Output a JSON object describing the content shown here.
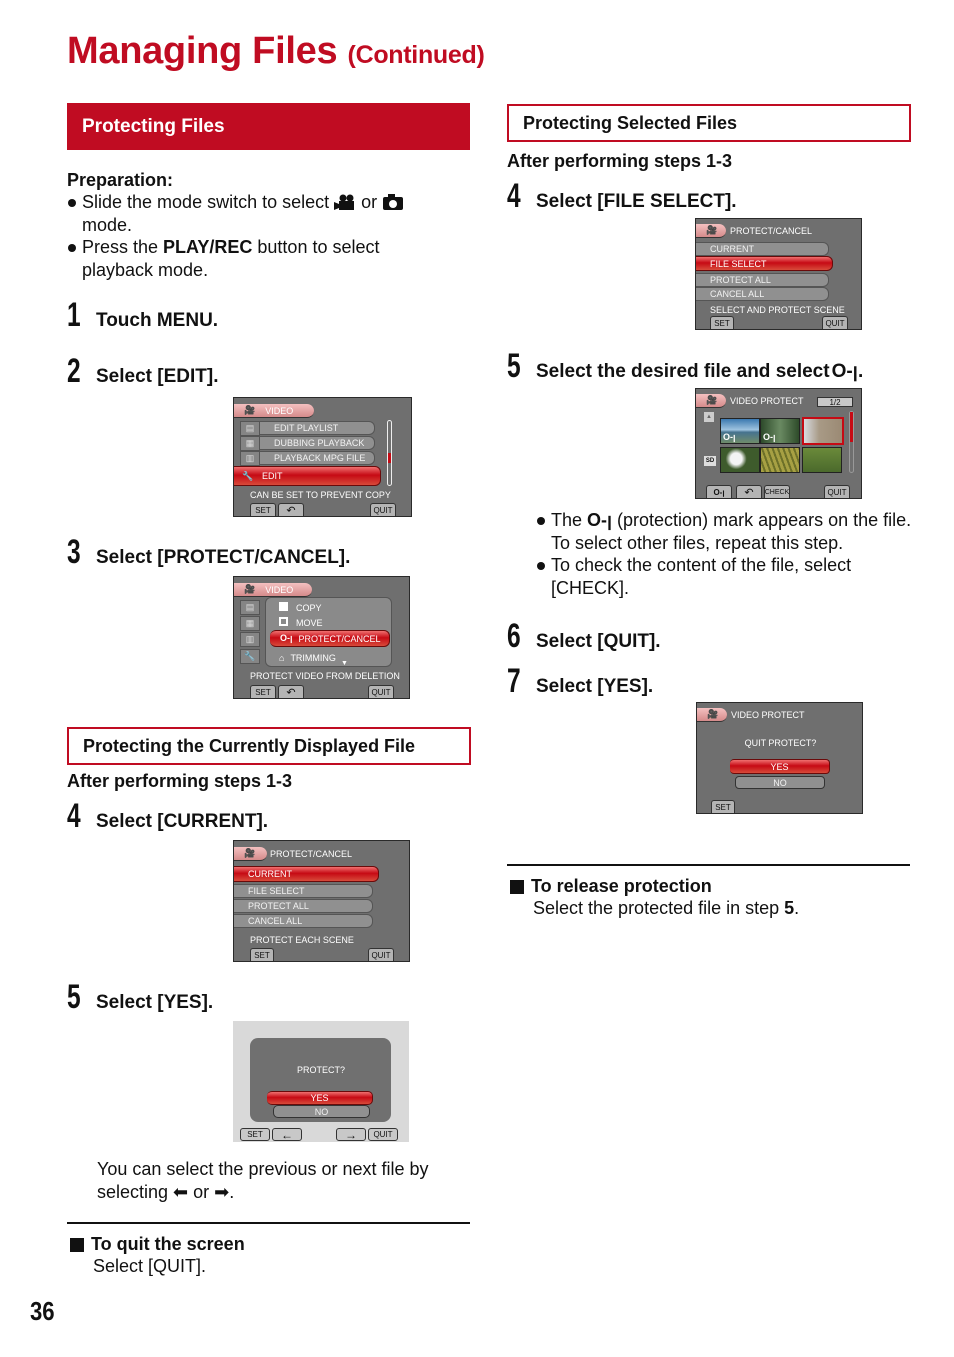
{
  "header": {
    "title": "Managing Files",
    "title_suffix": "(Continued)"
  },
  "left": {
    "section_title": "Protecting Files",
    "preparation": {
      "title": "Preparation:",
      "bullets": [
        {
          "before": "Slide the mode switch to select ",
          "icon1": "video-mode-icon",
          "mid": " or ",
          "icon2": "photo-mode-icon",
          "after": " mode."
        },
        {
          "before": "Press the ",
          "bold": "PLAY/REC",
          "after": " button to select playback mode."
        }
      ]
    },
    "steps": [
      {
        "num": "1",
        "text": "Touch MENU."
      },
      {
        "num": "2",
        "text": "Select [EDIT]."
      },
      {
        "num": "3",
        "text": "Select [PROTECT/CANCEL]."
      }
    ],
    "screen_edit": {
      "tab": "VIDEO",
      "items": [
        "EDIT PLAYLIST",
        "DUBBING PLAYBACK",
        "PLAYBACK MPG FILE",
        "EDIT"
      ],
      "selected": "EDIT",
      "hint": "CAN BE SET TO PREVENT COPY",
      "buttons": {
        "set": "SET",
        "back": "↶",
        "quit": "QUIT"
      },
      "scroll_position": 0.6
    },
    "screen_protect_menu": {
      "tab": "VIDEO",
      "items": [
        "COPY",
        "MOVE",
        "PROTECT/CANCEL",
        "TRIMMING"
      ],
      "selected": "PROTECT/CANCEL",
      "hint": "PROTECT VIDEO FROM DELETION",
      "buttons": {
        "set": "SET",
        "back": "↶",
        "quit": "QUIT"
      }
    },
    "subsection_title": "Protecting the Currently Displayed File",
    "after_steps": "After performing steps 1-3",
    "sub_steps": [
      {
        "num": "4",
        "text": "Select [CURRENT]."
      },
      {
        "num": "5",
        "text": "Select [YES]."
      }
    ],
    "screen_current": {
      "title": "PROTECT/CANCEL",
      "items": [
        "CURRENT",
        "FILE SELECT",
        "PROTECT ALL",
        "CANCEL ALL"
      ],
      "selected": "CURRENT",
      "hint": "PROTECT EACH SCENE",
      "buttons": {
        "set": "SET",
        "quit": "QUIT"
      }
    },
    "screen_yes": {
      "question": "PROTECT?",
      "yes": "YES",
      "no": "NO",
      "buttons": {
        "set": "SET",
        "prev": "←",
        "next": "→",
        "quit": "QUIT"
      }
    },
    "navigation_note": {
      "text_before": "You can select the previous or next file by selecting ",
      "arrow_left": "⬅",
      "mid": " or ",
      "arrow_right": "➡",
      "after": "."
    },
    "quit_note": {
      "title": "To quit the screen",
      "text": "Select [QUIT]."
    }
  },
  "right": {
    "section_title": "Protecting Selected Files",
    "after_steps": "After performing steps 1-3",
    "steps": [
      {
        "num": "4",
        "text": "Select [FILE SELECT]."
      },
      {
        "num": "5",
        "text": "Select the desired file and select ",
        "icon": "key-icon"
      },
      {
        "num": "6",
        "text": "Select [QUIT]."
      },
      {
        "num": "7",
        "text": "Select [YES]."
      }
    ],
    "screen_file_select": {
      "title": "PROTECT/CANCEL",
      "items": [
        "CURRENT",
        "FILE SELECT",
        "PROTECT ALL",
        "CANCEL ALL"
      ],
      "selected": "FILE SELECT",
      "hint": "SELECT AND PROTECT SCENE",
      "buttons": {
        "set": "SET",
        "quit": "QUIT"
      }
    },
    "screen_video_protect": {
      "title": "VIDEO PROTECT",
      "page": "1/2",
      "media_label": "SD",
      "thumbnails": [
        {
          "name": "thumb-seascape",
          "protected": true,
          "color": "#5a8bb0"
        },
        {
          "name": "thumb-forest-stream",
          "protected": true,
          "color": "#4f6b45"
        },
        {
          "name": "thumb-building",
          "protected": false,
          "selected": true,
          "color": "#b3a99a"
        },
        {
          "name": "thumb-white-flower",
          "protected": false,
          "color": "#3f5a2e"
        },
        {
          "name": "thumb-grass-yellow",
          "protected": false,
          "color": "#8f8a35"
        },
        {
          "name": "thumb-green-bush",
          "protected": false,
          "color": "#5f7a38"
        }
      ],
      "buttons": {
        "key": "O‑ꞁ",
        "back": "↶",
        "check": "CHECK",
        "quit": "QUIT"
      }
    },
    "step5_bullets": [
      {
        "before": "The ",
        "icon": "key-icon",
        "after": " (protection) mark appears on the file. To select other files, repeat this step."
      },
      {
        "before": "To check the content of the file, select [CHECK].",
        "icon": null,
        "after": ""
      }
    ],
    "screen_quit": {
      "title": "VIDEO PROTECT",
      "question": "QUIT PROTECT?",
      "yes": "YES",
      "no": "NO",
      "buttons": {
        "set": "SET"
      }
    },
    "release_note": {
      "title": "To release protection",
      "text_before": "Select the protected file in step ",
      "step_bold": "5",
      "after": "."
    }
  },
  "footer": {
    "page_number": "36"
  },
  "colors": {
    "brand_red": "#c00c22",
    "lcd_gray": "#6f6f6f"
  }
}
